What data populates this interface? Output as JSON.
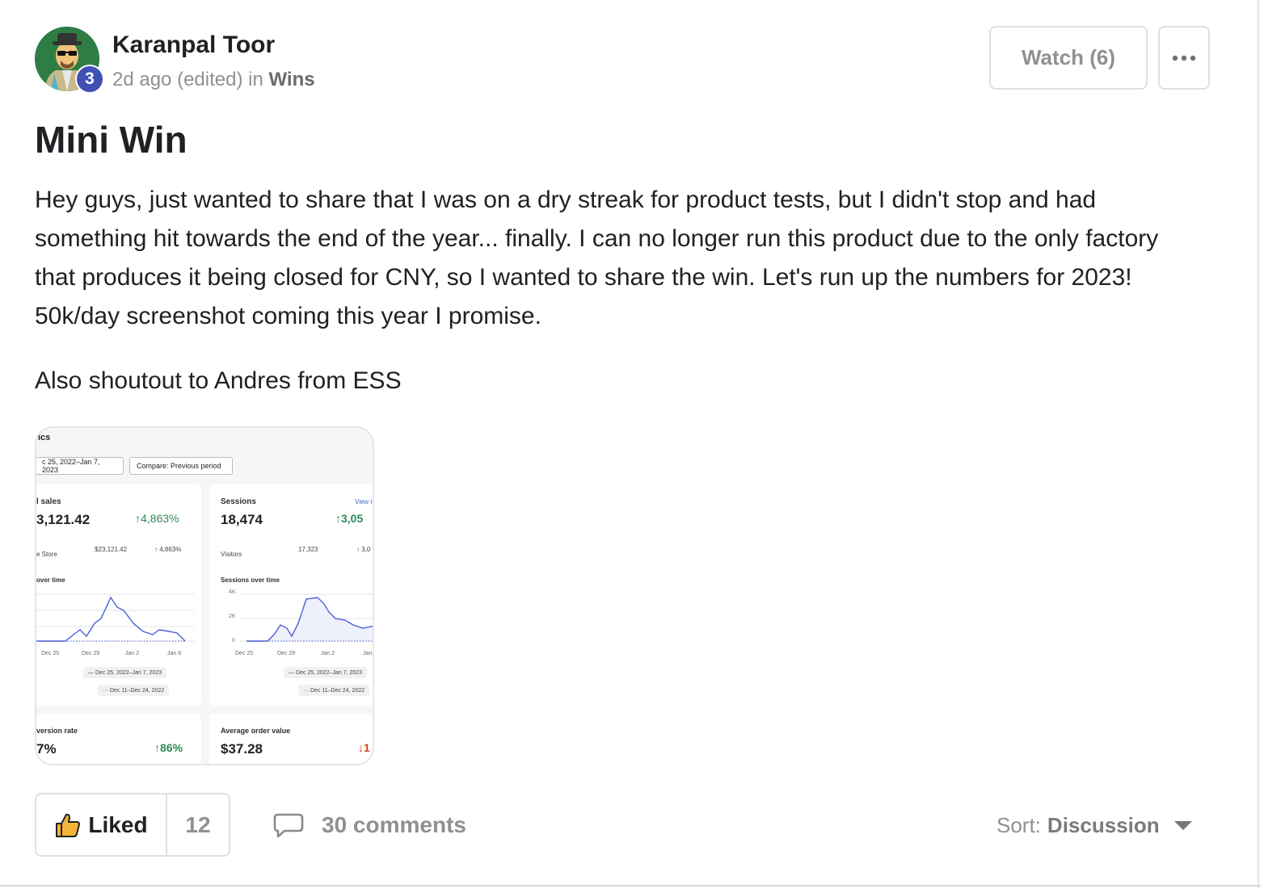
{
  "post": {
    "author": "Karanpal Toor",
    "level": "3",
    "time": "2d ago (edited)",
    "in_word": "in",
    "group": "Wins",
    "title": "Mini Win",
    "body": "Hey guys, just wanted to share that I was on a dry streak for product tests, but I didn't stop and had something hit towards the end of the year... finally. I can no longer run this product due to the only factory that produces it being closed for CNY, so I wanted to share the win. Let's run up the numbers for 2023! 50k/day screenshot coming this year I promise.",
    "body2": "Also shoutout to Andres from ESS"
  },
  "actions": {
    "watch_label": "Watch (6)",
    "more_icon": "more-horizontal-icon",
    "like_icon": "thumbs-up-icon",
    "like_label": "Liked",
    "like_count": "12",
    "comment_icon": "comment-bubble-icon",
    "comments_label": "30 comments",
    "sort_label": "Sort:",
    "sort_value": "Discussion",
    "sort_icon": "caret-down-icon"
  },
  "attachment": {
    "heading": "ics",
    "date_range": "c 25, 2022–Jan 7, 2023",
    "compare": "Compare: Previous period",
    "sales": {
      "label": "l sales",
      "value": "3,121.42",
      "change": "↑4,863%",
      "row_label": "e Store",
      "row_value": "$23,121.42",
      "row_change": "↑ 4,863%",
      "chart_label": "over time",
      "x_ticks": [
        "Dec 25",
        "Dec 29",
        "Jan 2",
        "Jan 6"
      ],
      "legend_current": "— Dec 25, 2022–Jan 7, 2023",
      "legend_previous": "··· Dec 11–Dec 24, 2022"
    },
    "sessions": {
      "label": "Sessions",
      "view": "View r",
      "value": "18,474",
      "change": "↑3,05",
      "row_label": "Visitors",
      "row_value": "17,323",
      "row_change": "↑ 3,0",
      "chart_label": "Sessions over time",
      "y_ticks": [
        "4K",
        "2K",
        "0"
      ],
      "x_ticks": [
        "Dec 25",
        "Dec 29",
        "Jan 2",
        "Jan"
      ],
      "legend_current": "— Dec 25, 2022–Jan 7, 2023",
      "legend_previous": "··· Dec 11–Dec 24, 2022"
    },
    "conversion": {
      "label": "version rate",
      "value": "7%",
      "change": "↑86%"
    },
    "aov": {
      "label": "Average order value",
      "value": "$37.28",
      "change": "↓1"
    },
    "colors": {
      "line": "#4a5fd6",
      "up": "#2e8a57",
      "down": "#d0451b"
    }
  }
}
